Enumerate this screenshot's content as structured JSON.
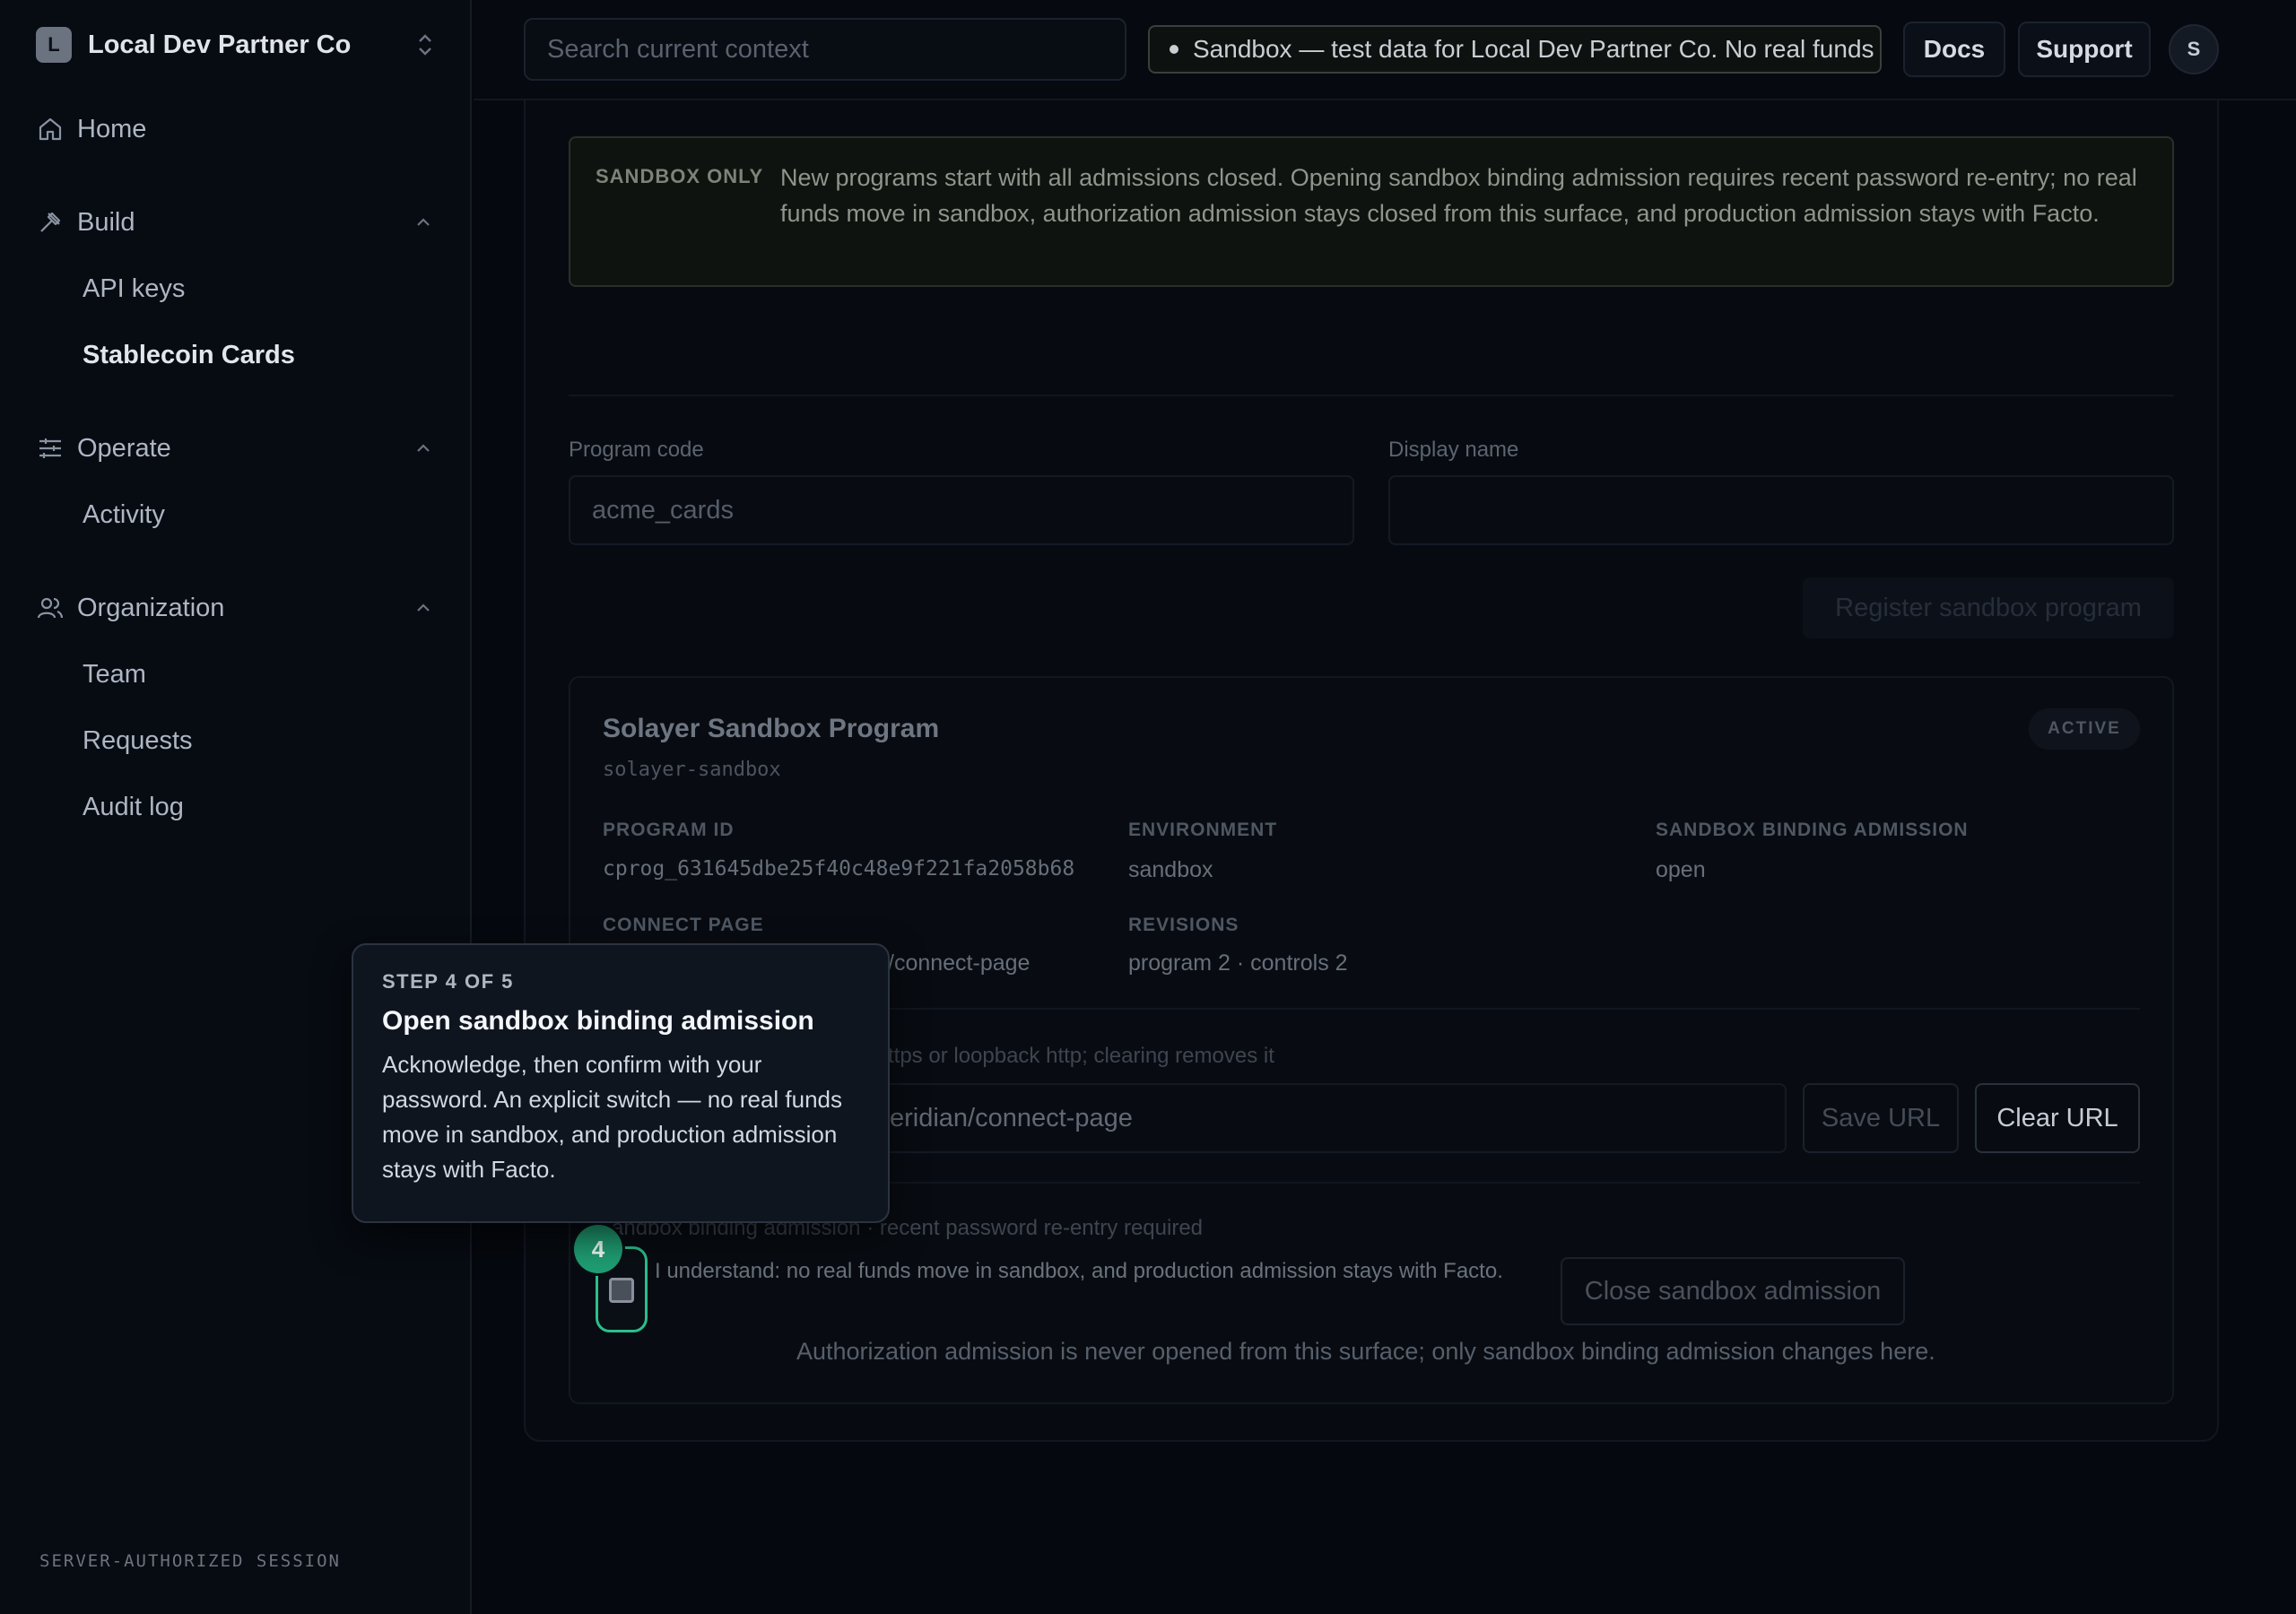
{
  "sidebar": {
    "org": {
      "initial": "L",
      "name": "Local Dev Partner Co"
    },
    "home": "Home",
    "sections": [
      {
        "label": "Build",
        "items": [
          "API keys",
          "Stablecoin Cards"
        ]
      },
      {
        "label": "Operate",
        "items": [
          "Activity"
        ]
      },
      {
        "label": "Organization",
        "items": [
          "Team",
          "Requests",
          "Audit log"
        ]
      }
    ],
    "active_item": "Stablecoin Cards",
    "session_tag": "SERVER-AUTHORIZED SESSION"
  },
  "topbar": {
    "search_placeholder": "Search current context",
    "sandbox_pill": "Sandbox — test data for Local Dev Partner Co. No real funds mo",
    "docs": "Docs",
    "support": "Support",
    "avatar_initial": "S"
  },
  "notice": {
    "tag": "SANDBOX ONLY",
    "text": "New programs start with all admissions closed. Opening sandbox binding admission requires recent password re-entry; no real funds move in sandbox, authorization admission stays closed from this surface, and production admission stays with Facto."
  },
  "form": {
    "program_code_label": "Program code",
    "program_code_placeholder": "acme_cards",
    "display_name_label": "Display name",
    "display_name_value": "",
    "register_button": "Register sandbox program"
  },
  "program": {
    "title": "Solayer Sandbox Program",
    "code": "solayer-sandbox",
    "status": "ACTIVE",
    "program_id_label": "PROGRAM ID",
    "program_id": "cprog_631645dbe25f40c48e9f221fa2058b68",
    "environment_label": "ENVIRONMENT",
    "environment": "sandbox",
    "binding_label": "SANDBOX BINDING ADMISSION",
    "binding": "open",
    "connect_label": "CONNECT PAGE",
    "connect_value": "/connect-page",
    "revisions_label": "REVISIONS",
    "revisions": "program 2 · controls 2",
    "url_hint": "ttps or loopback http; clearing removes it",
    "url_value": "eridian/connect-page",
    "save_url": "Save URL",
    "clear_url": "Clear URL",
    "admission_hint": "andbox binding admission · recent password re-entry required",
    "ack_text": "I understand: no real funds move in sandbox, and production admission stays with Facto.",
    "close_admission": "Close sandbox admission",
    "footnote": "Authorization admission is never opened from this surface; only sandbox binding admission changes here."
  },
  "tour": {
    "step": "STEP 4 OF 5",
    "title": "Open sandbox binding admission",
    "body": "Acknowledge, then confirm with your password. An explicit switch — no real funds move in sandbox, and production admission stays with Facto.",
    "step_number": "4",
    "accent": "#1f9e73"
  }
}
